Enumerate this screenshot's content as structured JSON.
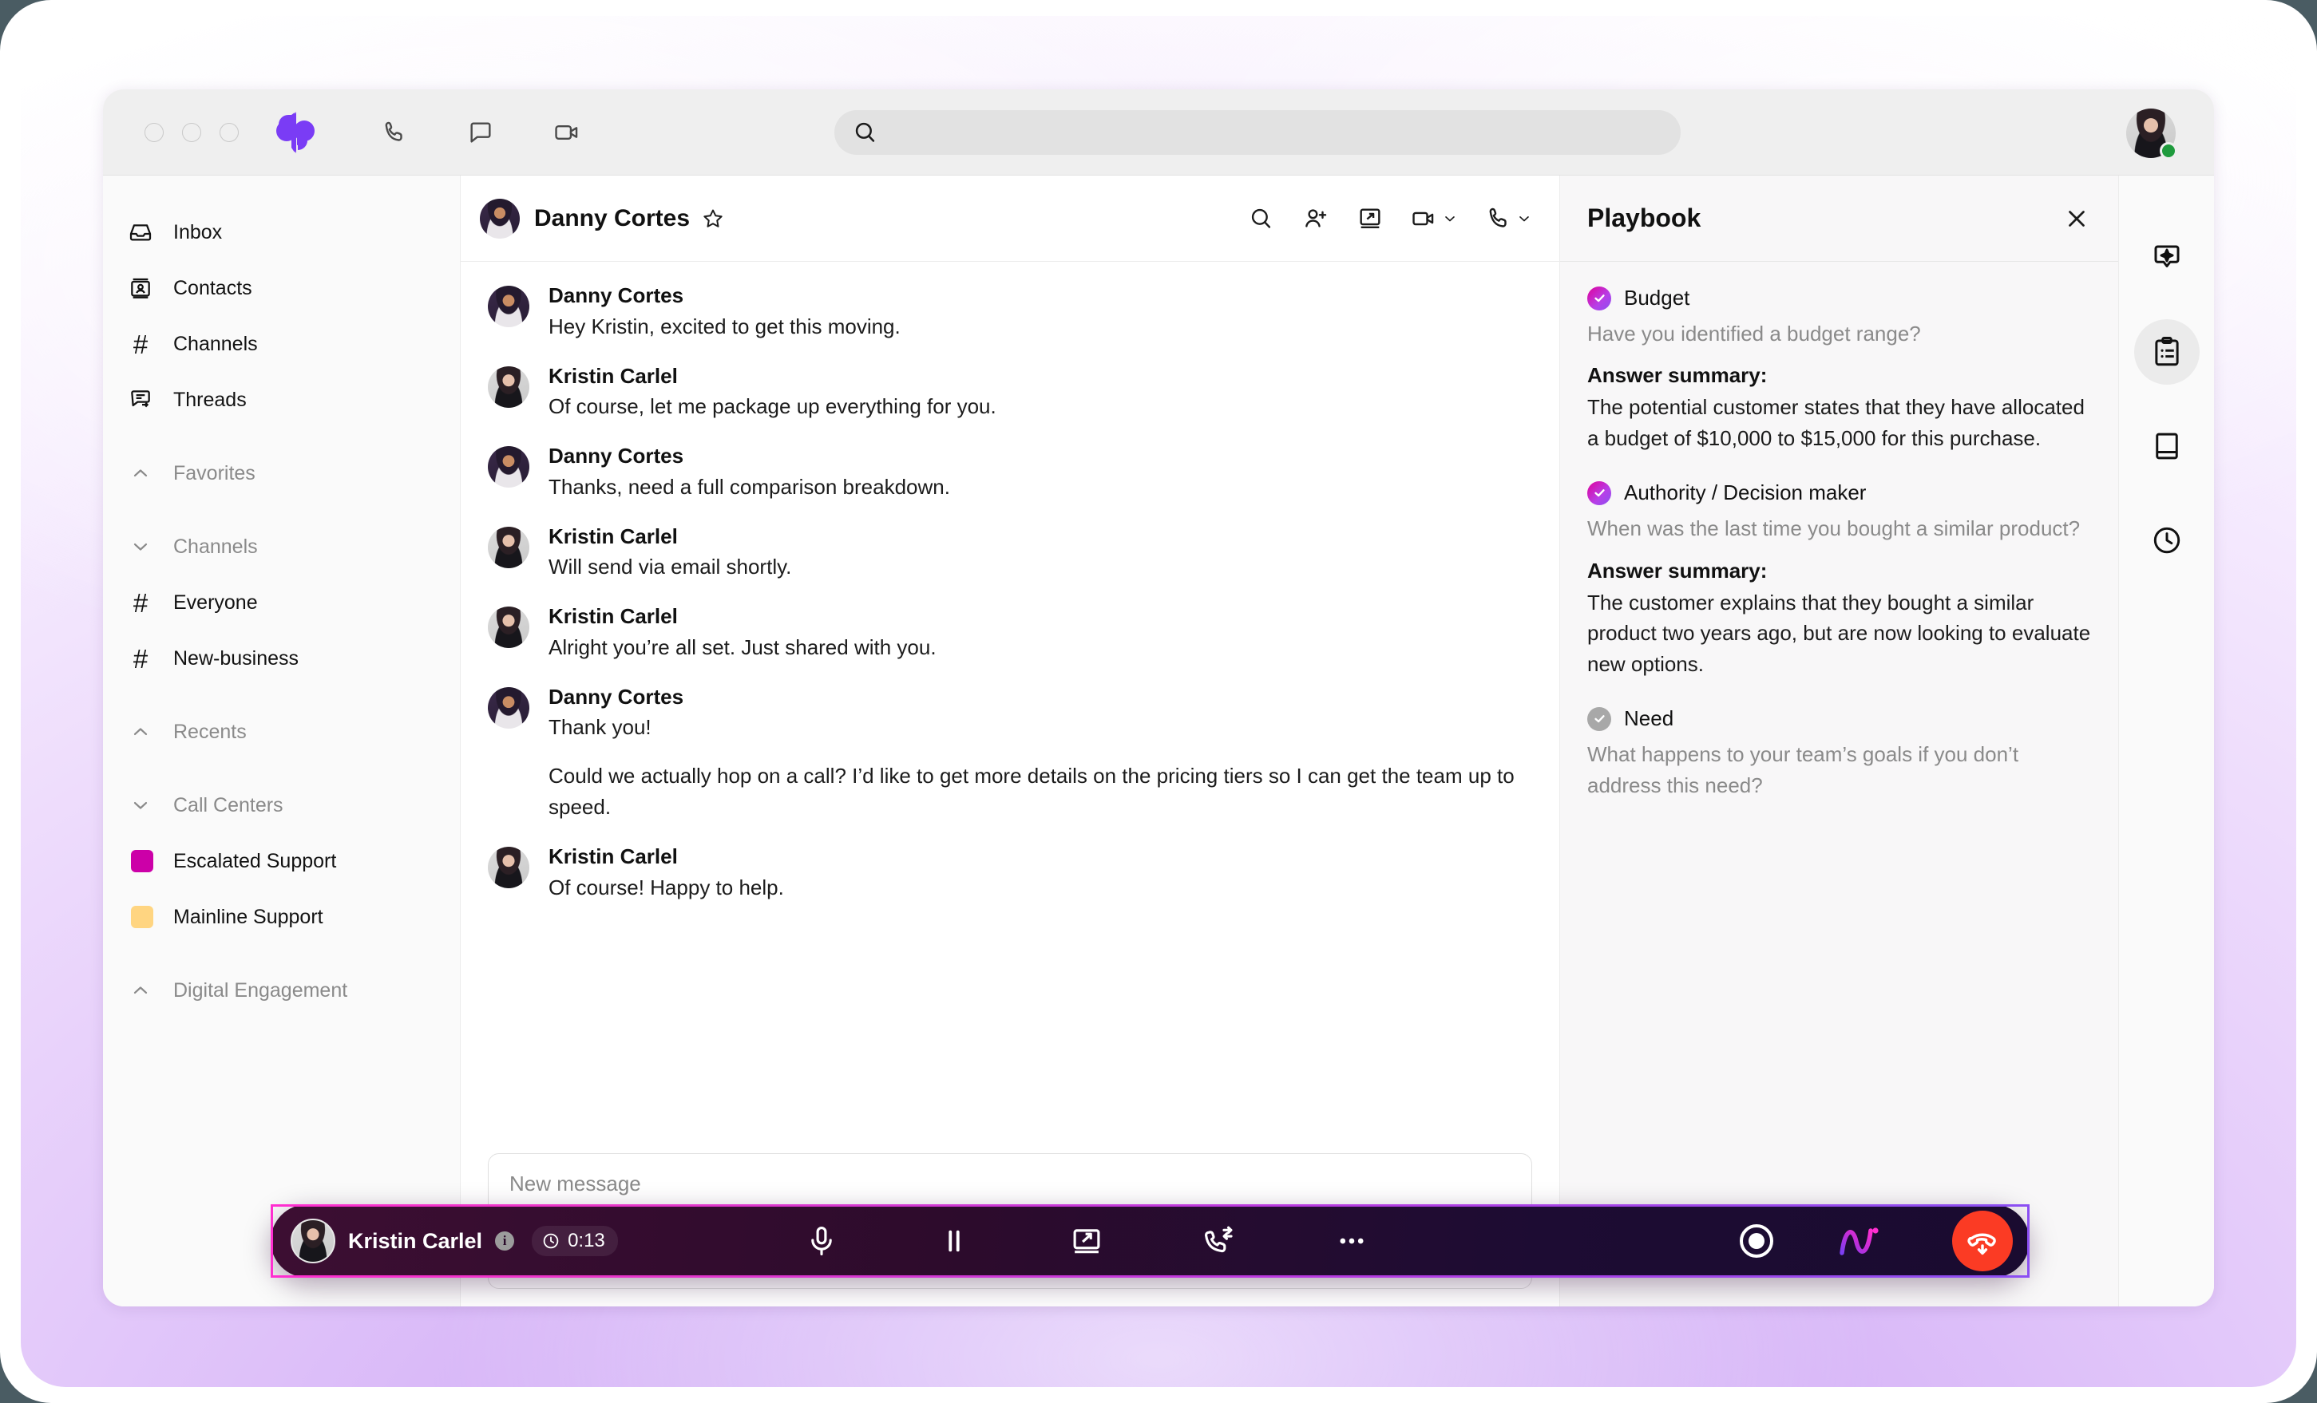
{
  "window": {
    "app_name": "Dialpad",
    "traffic_lights": [
      "close",
      "minimize",
      "maximize"
    ]
  },
  "topbar": {
    "icons": [
      "phone-icon",
      "chat-icon",
      "video-icon"
    ],
    "search": {
      "value": "",
      "placeholder": ""
    },
    "account": {
      "name": "Kristin Carlel",
      "status": "available",
      "status_color": "#1f9b3d"
    }
  },
  "sidebar": {
    "primary": [
      {
        "label": "Inbox",
        "icon": "inbox-icon"
      },
      {
        "label": "Contacts",
        "icon": "contacts-icon"
      },
      {
        "label": "Channels",
        "icon": "hash-icon"
      },
      {
        "label": "Threads",
        "icon": "threads-icon"
      }
    ],
    "sections": [
      {
        "label": "Favorites",
        "state": "expanded",
        "chevron": "chevron-up-icon",
        "items": []
      },
      {
        "label": "Channels",
        "state": "collapsed",
        "chevron": "chevron-down-icon",
        "items": [
          {
            "label": "Everyone",
            "icon": "hash-icon"
          },
          {
            "label": "New-business",
            "icon": "hash-icon"
          }
        ]
      },
      {
        "label": "Recents",
        "state": "expanded",
        "chevron": "chevron-up-icon",
        "items": []
      },
      {
        "label": "Call Centers",
        "state": "collapsed",
        "chevron": "chevron-down-icon",
        "items": [
          {
            "label": "Escalated Support",
            "icon": "color-swatch",
            "color": "#cc00a8"
          },
          {
            "label": "Mainline Support",
            "icon": "color-swatch",
            "color": "#ffd581"
          }
        ]
      },
      {
        "label": "Digital Engagement",
        "state": "expanded",
        "chevron": "chevron-up-icon",
        "items": []
      }
    ]
  },
  "conversation": {
    "title": "Danny Cortes",
    "favorite_icon": "star-icon",
    "actions": [
      {
        "name": "search-icon"
      },
      {
        "name": "add-person-icon"
      },
      {
        "name": "screen-share-icon"
      },
      {
        "name": "video-call-icon",
        "has_chevron": true
      },
      {
        "name": "phone-call-icon",
        "has_chevron": true
      }
    ],
    "messages": [
      {
        "sender": "Danny Cortes",
        "avatar": "dc",
        "lines": [
          "Hey Kristin, excited to get this moving."
        ]
      },
      {
        "sender": "Kristin Carlel",
        "avatar": "kr",
        "lines": [
          "Of course, let me package up everything for you."
        ]
      },
      {
        "sender": "Danny Cortes",
        "avatar": "dc",
        "lines": [
          "Thanks, need a full comparison breakdown."
        ]
      },
      {
        "sender": "Kristin Carlel",
        "avatar": "kr",
        "lines": [
          "Will send via email shortly."
        ]
      },
      {
        "sender": "Kristin Carlel",
        "avatar": "kr",
        "lines": [
          "Alright you’re all set. Just shared with you."
        ]
      },
      {
        "sender": "Danny Cortes",
        "avatar": "dc",
        "lines": [
          "Thank you!",
          "Could we actually hop on a call? I’d like to get more details on the pricing tiers so I can get the team up to speed."
        ]
      },
      {
        "sender": "Kristin Carlel",
        "avatar": "kr",
        "lines": [
          "Of course! Happy to help."
        ]
      }
    ],
    "composer": {
      "placeholder": "New message",
      "value": "",
      "tools": [
        "image-icon",
        "emoji-icon"
      ],
      "send_icon": "send-icon"
    }
  },
  "playbook": {
    "title": "Playbook",
    "close_icon": "close-icon",
    "answer_summary_label": "Answer summary:",
    "items": [
      {
        "label": "Budget",
        "checked": true,
        "question": "Have you identified a budget range?",
        "answer": "The potential customer states that they have allocated a budget of $10,000 to $15,000 for this purchase."
      },
      {
        "label": "Authority / Decision maker",
        "checked": true,
        "question": "When was the last time you bought a similar product?",
        "answer": "The customer explains that they bought a similar product two years ago, but are now looking to evaluate new options."
      },
      {
        "label": "Need",
        "checked": false,
        "question": "What happens to your team’s goals if you don’t address this need?",
        "answer": ""
      }
    ]
  },
  "right_rail": {
    "buttons": [
      {
        "name": "ai-assist-icon",
        "active": false
      },
      {
        "name": "playbook-clipboard-icon",
        "active": true
      },
      {
        "name": "notes-book-icon",
        "active": false
      },
      {
        "name": "history-clock-icon",
        "active": false
      }
    ]
  },
  "call_bar": {
    "contact": "Kristin Carlel",
    "info_icon": "info-icon",
    "timer": "0:13",
    "timer_icon": "clock-icon",
    "controls": [
      {
        "name": "mute-icon"
      },
      {
        "name": "hold-icon"
      },
      {
        "name": "share-screen-icon"
      },
      {
        "name": "transfer-call-icon"
      },
      {
        "name": "more-options-icon"
      }
    ],
    "record_icon": "record-icon",
    "ai_icon": "ai-logo-icon",
    "hangup_icon": "hangup-icon",
    "accent_color": "#ff2fd0"
  }
}
